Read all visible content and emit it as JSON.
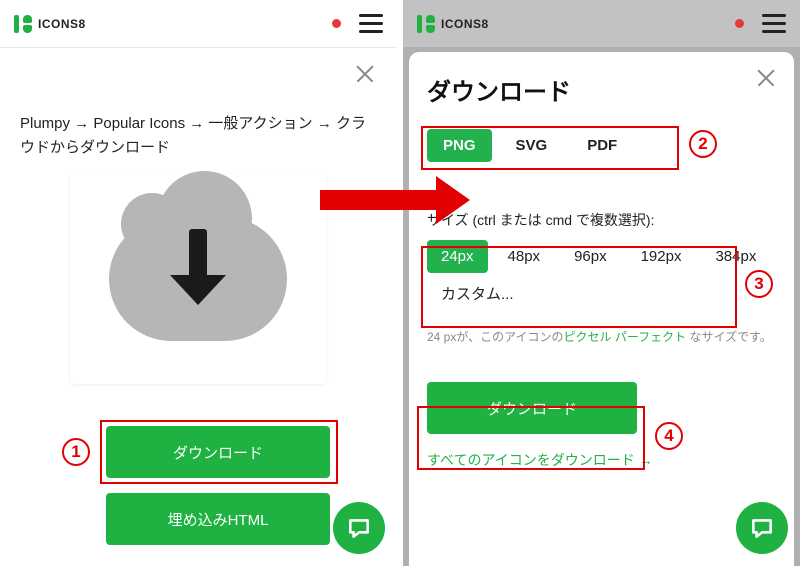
{
  "brand": "ICONS8",
  "left": {
    "breadcrumb": "Plumpy → Popular Icons → 一般アクション → クラウドからダウンロード",
    "download_label": "ダウンロード",
    "embed_label": "埋め込みHTML"
  },
  "right": {
    "title": "ダウンロード",
    "formats": [
      "PNG",
      "SVG",
      "PDF"
    ],
    "active_format": "PNG",
    "size_label": "サイズ (ctrl または cmd で複数選択):",
    "sizes": [
      "24px",
      "48px",
      "96px",
      "192px",
      "384px",
      "カスタム..."
    ],
    "active_size": "24px",
    "hint_pre": "24 pxが、このアイコンの",
    "hint_link": "ピクセル パーフェクト",
    "hint_post": " なサイズです。",
    "download_label": "ダウンロード",
    "all_link": "すべてのアイコンをダウンロード"
  },
  "annotations": {
    "1": "1",
    "2": "2",
    "3": "3",
    "4": "4"
  }
}
